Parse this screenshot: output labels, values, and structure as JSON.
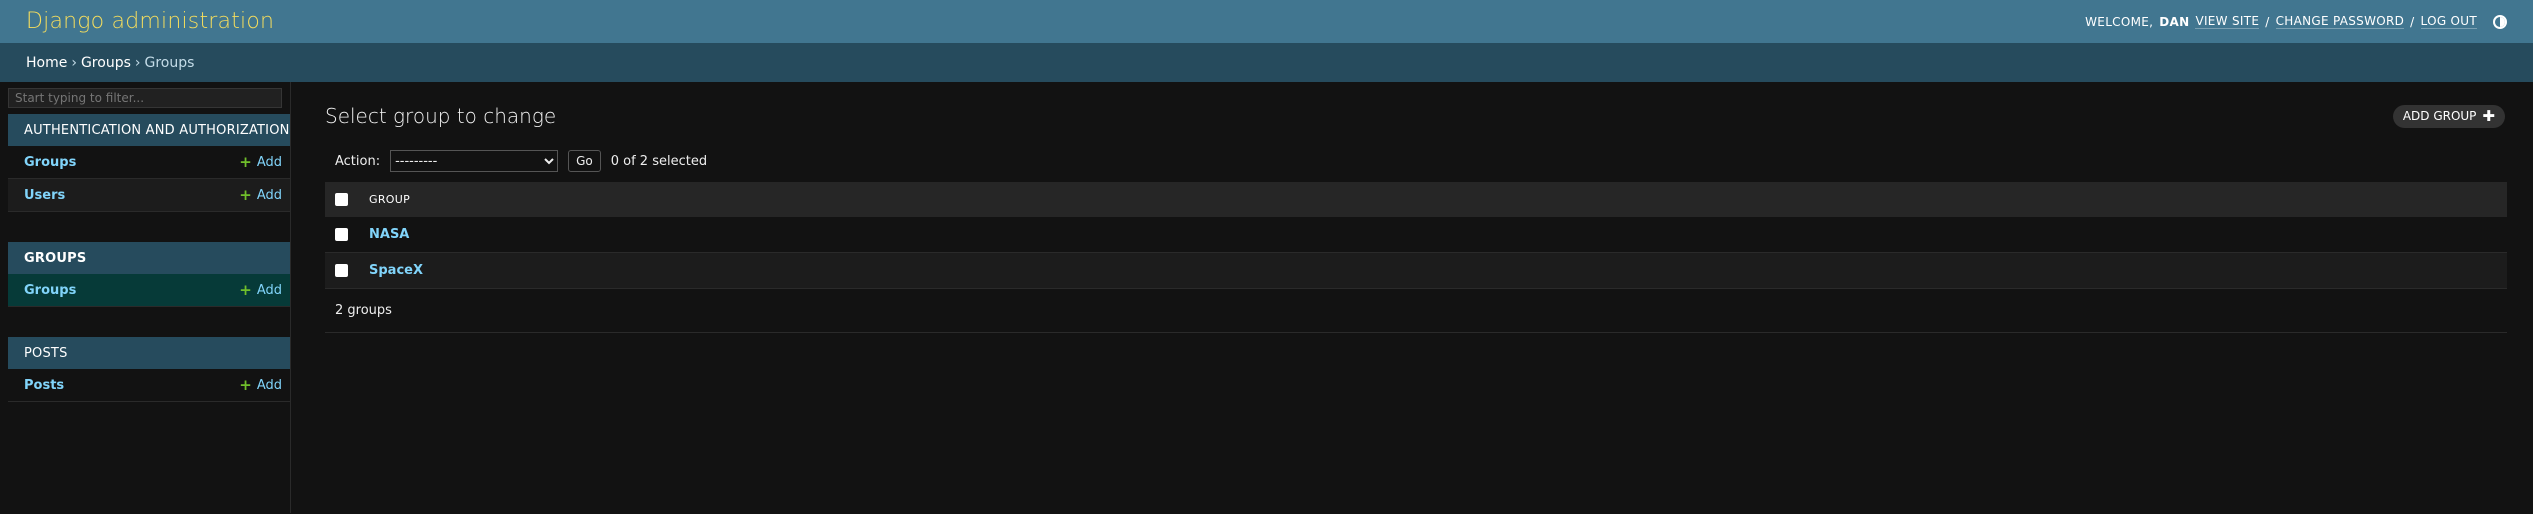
{
  "header": {
    "title": "Django administration",
    "welcome": "WELCOME,",
    "username": "DAN",
    "view_site": "VIEW SITE",
    "change_password": "CHANGE PASSWORD",
    "log_out": "LOG OUT",
    "sep": "/"
  },
  "breadcrumbs": {
    "home": "Home",
    "app": "Groups",
    "current": "Groups",
    "sep": "›"
  },
  "sidebar": {
    "filter_placeholder": "Start typing to filter...",
    "apps": [
      {
        "caption": "AUTHENTICATION AND AUTHORIZATION",
        "models": [
          {
            "name": "Groups",
            "add": "Add"
          },
          {
            "name": "Users",
            "add": "Add"
          }
        ]
      },
      {
        "caption": "GROUPS",
        "models": [
          {
            "name": "Groups",
            "add": "Add"
          }
        ]
      },
      {
        "caption": "POSTS",
        "models": [
          {
            "name": "Posts",
            "add": "Add"
          }
        ]
      }
    ]
  },
  "content": {
    "title": "Select group to change",
    "add_button": "ADD GROUP",
    "action_label": "Action:",
    "action_selected": "---------",
    "go_button": "Go",
    "selection_counter": "0 of 2 selected",
    "column_header": "GROUP",
    "rows": [
      "NASA",
      "SpaceX"
    ],
    "paginator": "2 groups"
  },
  "colors": {
    "header_bg": "#417690",
    "breadcrumbs_bg": "#264b5d",
    "brand_text": "#f5dd5d",
    "link": "#81d4fa",
    "add_plus": "#70bf2b",
    "background": "#121212"
  }
}
